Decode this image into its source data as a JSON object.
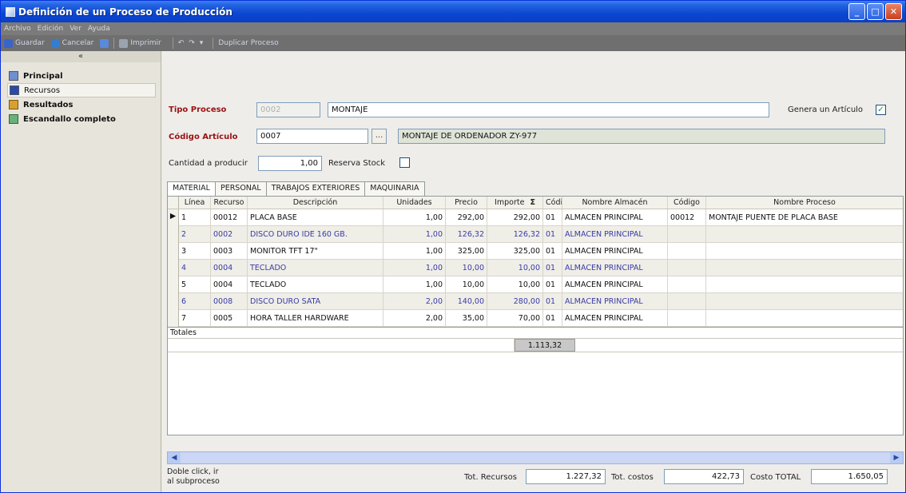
{
  "window": {
    "title": "Definición de un Proceso de Producción"
  },
  "menu": [
    "Archivo",
    "Edición",
    "Ver",
    "Ayuda"
  ],
  "toolbar": {
    "save": "Guardar",
    "cancel": "Cancelar",
    "print": "Imprimir",
    "duplicate": "Duplicar Proceso"
  },
  "nav": {
    "collapse": "«",
    "items": [
      {
        "label": "Principal",
        "bold": true
      },
      {
        "label": "Recursos",
        "bold": false
      },
      {
        "label": "Resultados",
        "bold": true
      },
      {
        "label": "Escandallo completo",
        "bold": true
      }
    ]
  },
  "form": {
    "tipo_proceso_label": "Tipo Proceso",
    "tipo_proceso_code": "0002",
    "tipo_proceso_value": "MONTAJE",
    "genera_articulo_label": "Genera un Artículo",
    "genera_articulo_checked": "✓",
    "codigo_articulo_label": "Código Artículo",
    "codigo_articulo_value": "0007",
    "ellipsis": "...",
    "articulo_desc": "MONTAJE DE ORDENADOR ZY-977",
    "cantidad_label": "Cantidad a producir",
    "cantidad_value": "1,00",
    "reserva_label": "Reserva Stock"
  },
  "tabs": [
    "MATERIAL",
    "PERSONAL",
    "TRABAJOS EXTERIORES",
    "MAQUINARIA"
  ],
  "grid": {
    "columns": [
      "Línea",
      "Recurso",
      "Descripción",
      "Unidades",
      "Precio",
      "Importe",
      "Σ",
      "Códi",
      "Nombre Almacén",
      "Código",
      "Nombre Proceso"
    ],
    "rows": [
      [
        "1",
        "00012",
        "PLACA BASE",
        "1,00",
        "292,00",
        "292,00",
        "01",
        "ALMACEN PRINCIPAL",
        "00012",
        "MONTAJE PUENTE DE PLACA BASE"
      ],
      [
        "2",
        "0002",
        "DISCO DURO IDE 160 GB.",
        "1,00",
        "126,32",
        "126,32",
        "01",
        "ALMACEN PRINCIPAL",
        "",
        ""
      ],
      [
        "3",
        "0003",
        "MONITOR TFT 17\"",
        "1,00",
        "325,00",
        "325,00",
        "01",
        "ALMACEN PRINCIPAL",
        "",
        ""
      ],
      [
        "4",
        "0004",
        "TECLADO",
        "1,00",
        "10,00",
        "10,00",
        "01",
        "ALMACEN PRINCIPAL",
        "",
        ""
      ],
      [
        "5",
        "0004",
        "TECLADO",
        "1,00",
        "10,00",
        "10,00",
        "01",
        "ALMACEN PRINCIPAL",
        "",
        ""
      ],
      [
        "6",
        "0008",
        "DISCO DURO SATA",
        "2,00",
        "140,00",
        "280,00",
        "01",
        "ALMACEN PRINCIPAL",
        "",
        ""
      ],
      [
        "7",
        "0005",
        "HORA TALLER HARDWARE",
        "2,00",
        "35,00",
        "70,00",
        "01",
        "ALMACEN PRINCIPAL",
        "",
        ""
      ]
    ],
    "row_indicator": "▶",
    "totals_label": "Totales",
    "totals_importe": "1.113,32"
  },
  "footer": {
    "note_line1": "Doble click, ir",
    "note_line2": "al subproceso",
    "tot_recursos_label": "Tot. Recursos",
    "tot_recursos_value": "1.227,32",
    "tot_costos_label": "Tot. costos",
    "tot_costos_value": "422,73",
    "costo_total_label": "Costo TOTAL",
    "costo_total_value": "1.650,05"
  },
  "colors": {
    "title_blue": "#0a47d1",
    "label_red": "#9b1212",
    "row_alt_text": "#3a3aa8"
  }
}
